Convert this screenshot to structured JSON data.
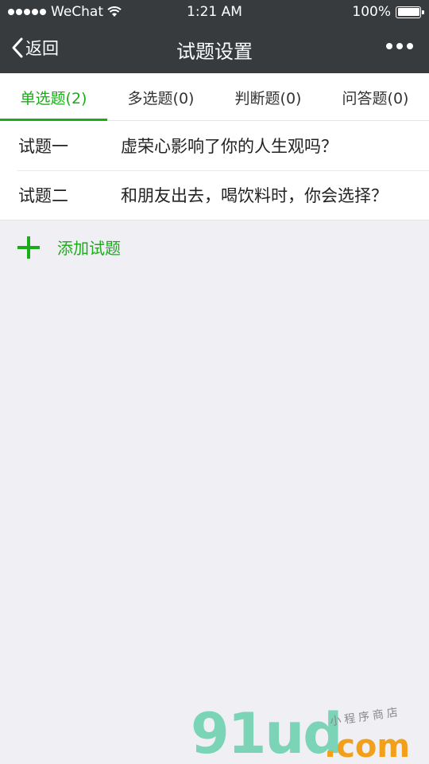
{
  "status_bar": {
    "carrier": "WeChat",
    "time": "1:21 AM",
    "battery_text": "100%",
    "battery_level": 1.0
  },
  "nav": {
    "back_label": "返回",
    "title": "试题设置"
  },
  "tabs": [
    {
      "label": "单选题(2)",
      "active": true
    },
    {
      "label": "多选题(0)",
      "active": false
    },
    {
      "label": "判断题(0)",
      "active": false
    },
    {
      "label": "问答题(0)",
      "active": false
    }
  ],
  "questions": [
    {
      "label": "试题一",
      "text": "虚荣心影响了你的人生观吗？"
    },
    {
      "label": "试题二",
      "text": "和朋友出去，喝饮料时，你会选择？"
    }
  ],
  "add": {
    "label": "添加试题"
  },
  "watermark": {
    "logo": "91ud",
    "tld": ".com",
    "subtitle": "小程序商店"
  },
  "colors": {
    "accent": "#1aad19",
    "nav_bg": "#373b3e",
    "page_bg": "#efeff4"
  }
}
